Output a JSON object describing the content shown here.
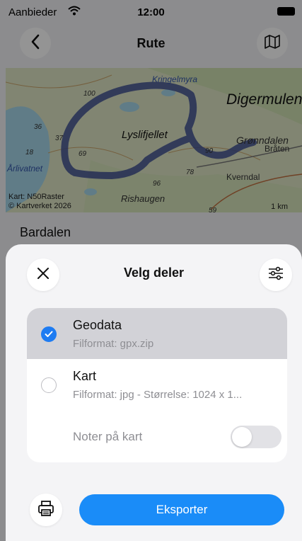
{
  "status_bar": {
    "carrier": "Aanbieder",
    "time": "12:00"
  },
  "nav": {
    "title": "Rute",
    "back_icon": "chevron-left-icon",
    "map_icon": "map-icon"
  },
  "map": {
    "labels": [
      "Kringelmyra",
      "Digermulen",
      "Lyslifjellet",
      "Grønndalen",
      "Bråten",
      "Årlivatnet",
      "Kverndal",
      "Rishaugen",
      "100",
      "36",
      "37",
      "69",
      "18",
      "90",
      "78",
      "96",
      "59"
    ],
    "credit_line1": "Kart: N50Raster",
    "credit_line2": "© Kartverket 2026",
    "scale": "1 km",
    "route_color": "#3e4f92"
  },
  "route": {
    "name": "Bardalen"
  },
  "sheet": {
    "title": "Velg deler",
    "options": [
      {
        "label": "Geodata",
        "subtitle": "Filformat: gpx.zip",
        "selected": true
      },
      {
        "label": "Kart",
        "subtitle": "Filformat: jpg - Størrelse: 1024 x 1...",
        "selected": false
      }
    ],
    "toggle": {
      "label": "Noter på kart",
      "on": false
    },
    "export_label": "Eksporter",
    "accent": "#1a8cf8"
  }
}
